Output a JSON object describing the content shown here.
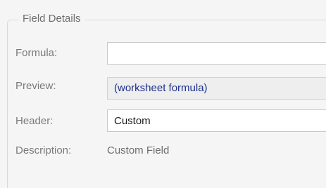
{
  "section": {
    "legend": "Field Details"
  },
  "formula": {
    "label": "Formula:",
    "value": ""
  },
  "preview": {
    "label": "Preview:",
    "value": "(worksheet formula)"
  },
  "header": {
    "label": "Header:",
    "value": "Custom"
  },
  "description": {
    "label": "Description:",
    "value": "Custom Field"
  },
  "colors": {
    "preview_text": "#1b2f8c",
    "label_text": "#7a7a7a"
  }
}
